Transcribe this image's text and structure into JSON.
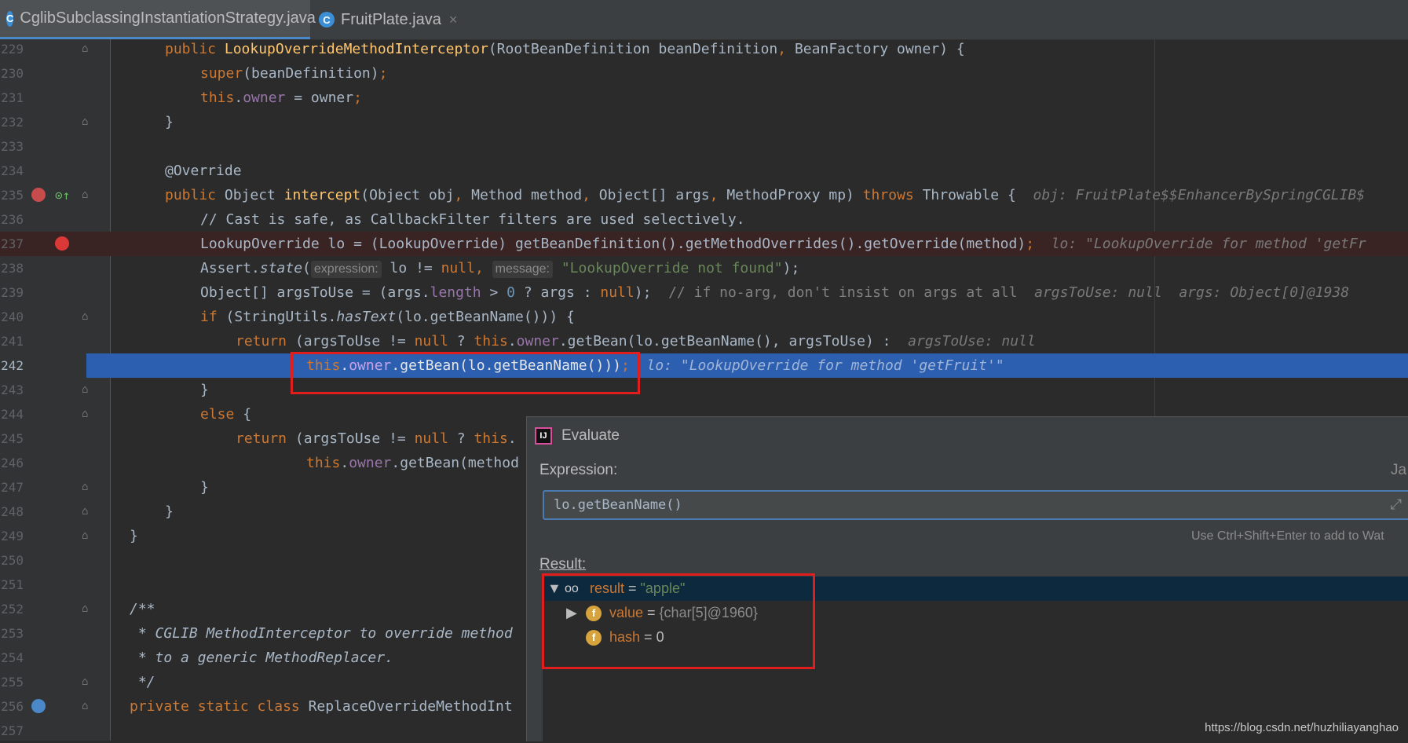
{
  "tabs": [
    {
      "label": "CglibSubclassingInstantiationStrategy.java",
      "icon": "class-icon",
      "active": true
    },
    {
      "label": "FruitPlate.java",
      "icon": "class-icon",
      "active": false
    }
  ],
  "editor": {
    "lines": [
      {
        "num": "229"
      },
      {
        "num": "230"
      },
      {
        "num": "231"
      },
      {
        "num": "232"
      },
      {
        "num": "233"
      },
      {
        "num": "234"
      },
      {
        "num": "235"
      },
      {
        "num": "236"
      },
      {
        "num": "237"
      },
      {
        "num": "238"
      },
      {
        "num": "239"
      },
      {
        "num": "240"
      },
      {
        "num": "241"
      },
      {
        "num": "242"
      },
      {
        "num": "243"
      },
      {
        "num": "244"
      },
      {
        "num": "245"
      },
      {
        "num": "246"
      },
      {
        "num": "247"
      },
      {
        "num": "248"
      },
      {
        "num": "249"
      },
      {
        "num": "250"
      },
      {
        "num": "251"
      },
      {
        "num": "252"
      },
      {
        "num": "253"
      },
      {
        "num": "254"
      },
      {
        "num": "255"
      },
      {
        "num": "256"
      },
      {
        "num": "257"
      }
    ],
    "code": {
      "l229": {
        "a": "public ",
        "b": "LookupOverrideMethodInterceptor",
        "c": "(RootBeanDefinition beanDefinition",
        "d": ", ",
        "e": "BeanFactory owner) {"
      },
      "l230": {
        "a": "super",
        "b": "(beanDefinition)",
        "c": ";"
      },
      "l231": {
        "a": "this",
        "b": ".",
        "c": "owner",
        "d": " = owner",
        "e": ";"
      },
      "l232": "}",
      "l234": "@Override",
      "l235": {
        "a": "public ",
        "b": "Object ",
        "c": "intercept",
        "d": "(Object obj",
        "e": ", ",
        "f": "Method method",
        "g": ", ",
        "h": "Object[] args",
        "i": ", ",
        "j": "MethodProxy mp) ",
        "k": "throws ",
        "l": "Throwable {",
        "hint": "obj: FruitPlate$$EnhancerBySpringCGLIB$"
      },
      "l236": "// Cast is safe, as CallbackFilter filters are used selectively.",
      "l237": {
        "a": "LookupOverride lo = (LookupOverride) getBeanDefinition().getMethodOverrides().getOverride(method)",
        "b": ";",
        "hint": "lo: \"LookupOverride for method 'getFr"
      },
      "l238": {
        "a": "Assert.",
        "b": "state",
        "c": "(",
        "p1": "expression:",
        "d": " lo != ",
        "e": "null",
        "f": ", ",
        "p2": "message:",
        "g": " \"LookupOverride not found\"",
        "h": ");"
      },
      "l239": {
        "a": "Object[] argsToUse = (args.",
        "b": "length",
        "c": " > ",
        "d": "0",
        "e": " ? args : ",
        "f": "null",
        "g": ");  ",
        "h": "// if no-arg, don't insist on args at all",
        "hint": "argsToUse: null  args: Object[0]@1938"
      },
      "l240": {
        "a": "if ",
        "b": "(StringUtils.",
        "c": "hasText",
        "d": "(lo.getBeanName())) {"
      },
      "l241": {
        "a": "return ",
        "b": "(argsToUse != ",
        "c": "null ",
        "d": "? ",
        "e": "this",
        "f": ".",
        "g": "owner",
        "h": ".getBean(lo.getBeanName(), argsToUse) :",
        "hint": "argsToUse: null"
      },
      "l242": {
        "a": "this",
        "b": ".",
        "c": "owner",
        "d": ".getBean(lo.getBeanName()))",
        "e": ";",
        "hint": "lo: \"LookupOverride for method 'getFruit'\""
      },
      "l243": "}",
      "l244": {
        "a": "else ",
        "b": "{"
      },
      "l245": {
        "a": "return ",
        "b": "(argsToUse != ",
        "c": "null ",
        "d": "? ",
        "e": "this",
        "f": "."
      },
      "l246": {
        "a": "this",
        "b": ".",
        "c": "owner",
        "d": ".getBean(method"
      },
      "l247": "}",
      "l248": "}",
      "l249": "}",
      "l252": "/**",
      "l253": " * CGLIB MethodInterceptor to override method",
      "l254": " * to a generic MethodReplacer.",
      "l255": " */",
      "l256": {
        "a": "private static class ",
        "b": "ReplaceOverrideMethodInt"
      }
    }
  },
  "evaluate": {
    "title": "Evaluate",
    "expression_label": "Expression:",
    "expression_value": "lo.getBeanName()",
    "right_cut": "Ja",
    "hint": "Use Ctrl+Shift+Enter to add to Wat",
    "result_label": "Result:",
    "result": {
      "name": "result",
      "eq": " = ",
      "value": "\"apple\"",
      "children": [
        {
          "name": "value",
          "eq": " = ",
          "value": "{char[5]@1960}"
        },
        {
          "name": "hash",
          "eq": " = ",
          "value": "0"
        }
      ]
    }
  },
  "watermark": "https://blog.csdn.net/huzhiliayanghao",
  "colors": {
    "breakpoint": "#db3838",
    "execution_line": "#2d5fb0",
    "highlight_box": "#e01e1e",
    "string": "#6a8759",
    "keyword": "#cc7832"
  }
}
